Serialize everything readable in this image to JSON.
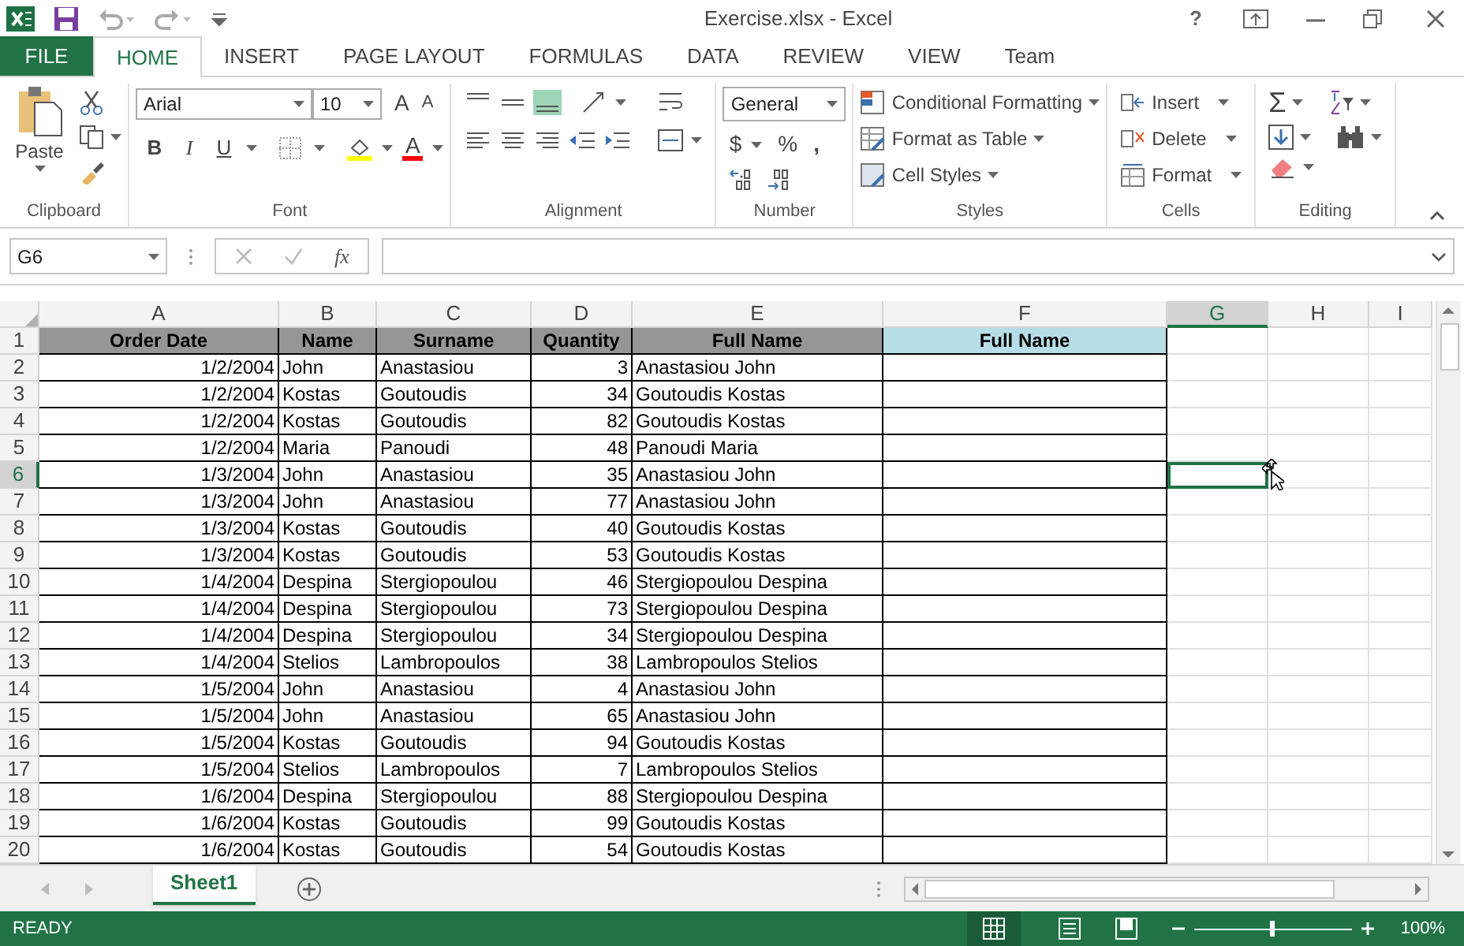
{
  "window": {
    "title": "Exercise.xlsx - Excel",
    "help": "?"
  },
  "file_tab": "FILE",
  "tabs": [
    {
      "label": "HOME",
      "selected": true
    },
    {
      "label": "INSERT",
      "selected": false
    },
    {
      "label": "PAGE LAYOUT",
      "selected": false
    },
    {
      "label": "FORMULAS",
      "selected": false
    },
    {
      "label": "DATA",
      "selected": false
    },
    {
      "label": "REVIEW",
      "selected": false
    },
    {
      "label": "VIEW",
      "selected": false
    },
    {
      "label": "Team",
      "selected": false
    }
  ],
  "ribbon": {
    "clipboard": {
      "label": "Clipboard",
      "paste": "Paste"
    },
    "font": {
      "label": "Font",
      "font_name": "Arial",
      "font_size": "10",
      "grow": "A",
      "shrink": "A",
      "styles": [
        "B",
        "I",
        "U"
      ],
      "font_color": "A"
    },
    "alignment": {
      "label": "Alignment"
    },
    "number": {
      "label": "Number",
      "format": "General",
      "currency": "$",
      "percent": "%",
      "comma": ","
    },
    "styles": {
      "label": "Styles",
      "items": [
        "Conditional Formatting",
        "Format as Table",
        "Cell Styles"
      ]
    },
    "cells": {
      "label": "Cells",
      "items": [
        "Insert",
        "Delete",
        "Format"
      ]
    },
    "editing": {
      "label": "Editing",
      "sum": "Σ"
    }
  },
  "formula_bar": {
    "name_box": "G6",
    "function": "fx"
  },
  "sheet": {
    "columns": [
      {
        "label": "A",
        "selected": false
      },
      {
        "label": "B",
        "selected": false
      },
      {
        "label": "C",
        "selected": false
      },
      {
        "label": "D",
        "selected": false
      },
      {
        "label": "E",
        "selected": false
      },
      {
        "label": "F",
        "selected": false
      },
      {
        "label": "G",
        "selected": true
      },
      {
        "label": "H",
        "selected": false
      },
      {
        "label": "I",
        "selected": false
      }
    ],
    "header_row_number": "1",
    "header": [
      "Order Date",
      "Name",
      "Surname",
      "Quantity",
      "Full Name",
      "Full Name"
    ],
    "rows": [
      {
        "number": "2",
        "selected": false,
        "cells": [
          "1/2/2004",
          "John",
          "Anastasiou",
          "3",
          "Anastasiou John"
        ]
      },
      {
        "number": "3",
        "selected": false,
        "cells": [
          "1/2/2004",
          "Kostas",
          "Goutoudis",
          "34",
          "Goutoudis Kostas"
        ]
      },
      {
        "number": "4",
        "selected": false,
        "cells": [
          "1/2/2004",
          "Kostas",
          "Goutoudis",
          "82",
          "Goutoudis Kostas"
        ]
      },
      {
        "number": "5",
        "selected": false,
        "cells": [
          "1/2/2004",
          "Maria",
          "Panoudi",
          "48",
          "Panoudi Maria"
        ]
      },
      {
        "number": "6",
        "selected": true,
        "cells": [
          "1/3/2004",
          "John",
          "Anastasiou",
          "35",
          "Anastasiou John"
        ]
      },
      {
        "number": "7",
        "selected": false,
        "cells": [
          "1/3/2004",
          "John",
          "Anastasiou",
          "77",
          "Anastasiou John"
        ]
      },
      {
        "number": "8",
        "selected": false,
        "cells": [
          "1/3/2004",
          "Kostas",
          "Goutoudis",
          "40",
          "Goutoudis Kostas"
        ]
      },
      {
        "number": "9",
        "selected": false,
        "cells": [
          "1/3/2004",
          "Kostas",
          "Goutoudis",
          "53",
          "Goutoudis Kostas"
        ]
      },
      {
        "number": "10",
        "selected": false,
        "cells": [
          "1/4/2004",
          "Despina",
          "Stergiopoulou",
          "46",
          "Stergiopoulou Despina"
        ]
      },
      {
        "number": "11",
        "selected": false,
        "cells": [
          "1/4/2004",
          "Despina",
          "Stergiopoulou",
          "73",
          "Stergiopoulou Despina"
        ]
      },
      {
        "number": "12",
        "selected": false,
        "cells": [
          "1/4/2004",
          "Despina",
          "Stergiopoulou",
          "34",
          "Stergiopoulou Despina"
        ]
      },
      {
        "number": "13",
        "selected": false,
        "cells": [
          "1/4/2004",
          "Stelios",
          "Lambropoulos",
          "38",
          "Lambropoulos Stelios"
        ]
      },
      {
        "number": "14",
        "selected": false,
        "cells": [
          "1/5/2004",
          "John",
          "Anastasiou",
          "4",
          "Anastasiou John"
        ]
      },
      {
        "number": "15",
        "selected": false,
        "cells": [
          "1/5/2004",
          "John",
          "Anastasiou",
          "65",
          "Anastasiou John"
        ]
      },
      {
        "number": "16",
        "selected": false,
        "cells": [
          "1/5/2004",
          "Kostas",
          "Goutoudis",
          "94",
          "Goutoudis Kostas"
        ]
      },
      {
        "number": "17",
        "selected": false,
        "cells": [
          "1/5/2004",
          "Stelios",
          "Lambropoulos",
          "7",
          "Lambropoulos Stelios"
        ]
      },
      {
        "number": "18",
        "selected": false,
        "cells": [
          "1/6/2004",
          "Despina",
          "Stergiopoulou",
          "88",
          "Stergiopoulou Despina"
        ]
      },
      {
        "number": "19",
        "selected": false,
        "cells": [
          "1/6/2004",
          "Kostas",
          "Goutoudis",
          "99",
          "Goutoudis Kostas"
        ]
      },
      {
        "number": "20",
        "selected": false,
        "cells": [
          "1/6/2004",
          "Kostas",
          "Goutoudis",
          "54",
          "Goutoudis Kostas"
        ]
      }
    ]
  },
  "sheet_tabs": [
    {
      "label": "Sheet1",
      "selected": true
    }
  ],
  "status_bar": {
    "status": "READY",
    "zoom": "100%",
    "zoom_slider": {
      "level": 0.5
    }
  }
}
